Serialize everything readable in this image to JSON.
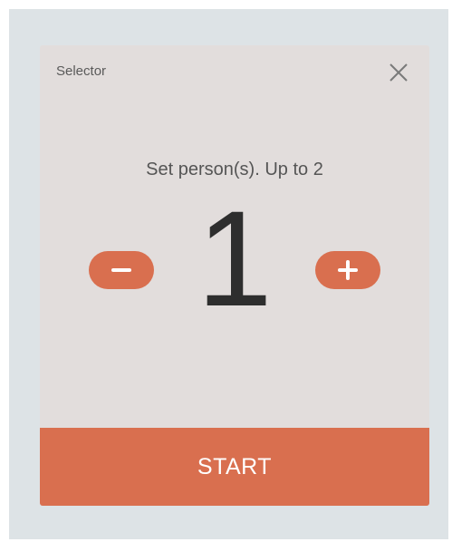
{
  "dialog": {
    "title": "Selector",
    "close_icon": "close-icon"
  },
  "selector": {
    "prompt": "Set person(s). Up to 2",
    "count": "1",
    "decrement_icon": "minus-icon",
    "increment_icon": "plus-icon"
  },
  "actions": {
    "start_label": "START"
  },
  "colors": {
    "accent": "#d96f4f",
    "dialog_background": "#e2dddc",
    "screen_background": "#dde3e6",
    "count_text": "#2e2e2e"
  }
}
